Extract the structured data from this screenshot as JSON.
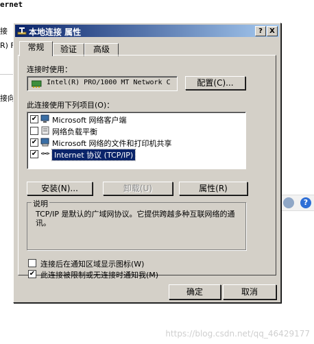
{
  "background": {
    "title_fragment": "ernet",
    "left_fragments": [
      "接",
      "R) F",
      "接向"
    ]
  },
  "dialog": {
    "title": "本地连接 属性",
    "help_btn": "?",
    "close_btn": "X",
    "tabs": [
      "常规",
      "验证",
      "高级"
    ],
    "connect_using_label": "连接时使用：",
    "adapter_name": "Intel(R) PRO/1000 MT Network C",
    "configure_btn": "配置(C)...",
    "items_label": "此连接使用下列项目(O)：",
    "items": [
      {
        "label": "Microsoft 网络客户端",
        "checked": true,
        "icon": "network-client-icon"
      },
      {
        "label": "网络负载平衡",
        "checked": false,
        "icon": "load-balance-icon"
      },
      {
        "label": "Microsoft 网络的文件和打印机共享",
        "checked": true,
        "icon": "file-printer-share-icon"
      },
      {
        "label": "Internet 协议 (TCP/IP)",
        "checked": true,
        "icon": "protocol-icon",
        "selected": true
      }
    ],
    "install_btn": "安装(N)...",
    "uninstall_btn": "卸载(U)",
    "properties_btn": "属性(R)",
    "description_label": "说明",
    "description_text": "TCP/IP 是默认的广域网协议。它提供跨越多种互联网络的通讯。",
    "show_icon_checkbox": {
      "label": "连接后在通知区域显示图标(W)",
      "checked": false
    },
    "notify_checkbox": {
      "label": "此连接被限制或无连接时通知我(M)",
      "checked": true
    },
    "ok_btn": "确定",
    "cancel_btn": "取消"
  },
  "watermark": "https://blog.csdn.net/qq_46429177",
  "colors": {
    "title_start": "#0a246a",
    "title_end": "#a6caf0",
    "dialog_face": "#d4d0c8",
    "selection": "#0a246a"
  }
}
